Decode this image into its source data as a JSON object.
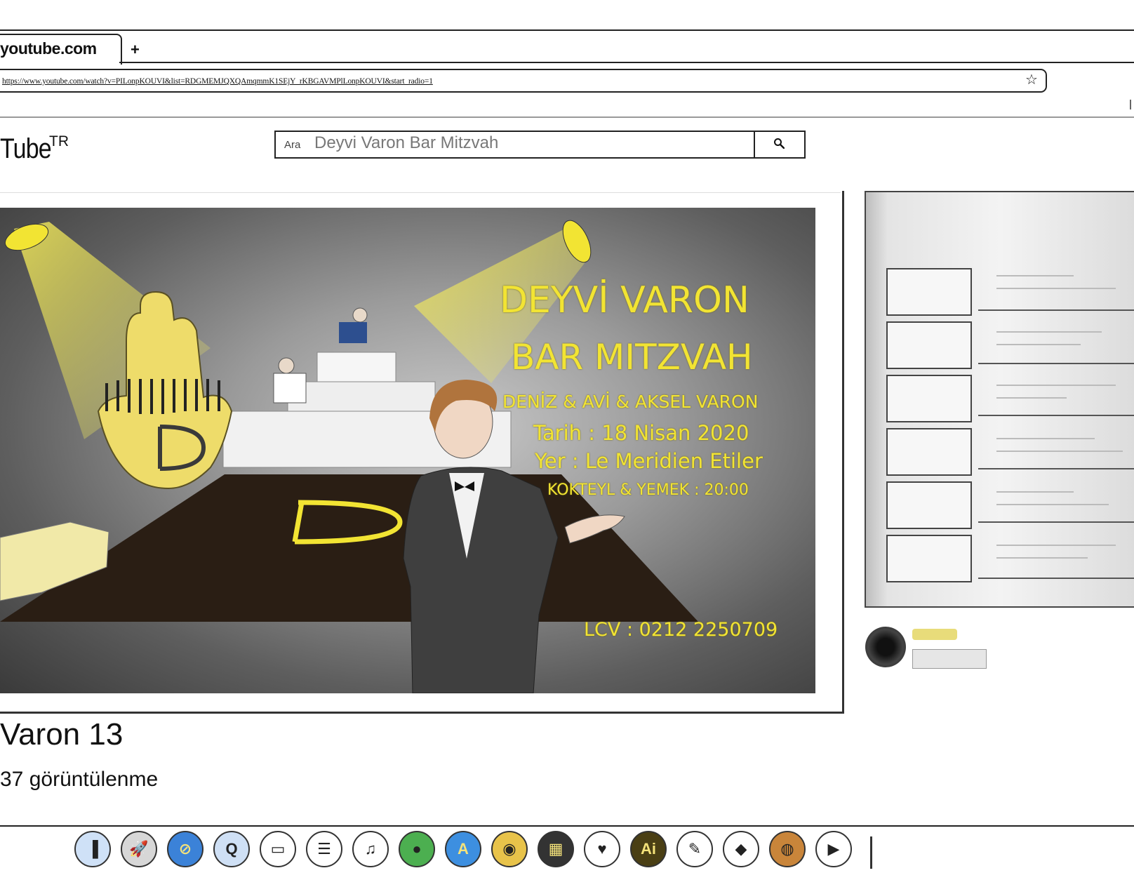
{
  "browser": {
    "tab_title": "youtube.com",
    "new_tab": "+",
    "url": "https://www.youtube.com/watch?v=PILonpKOUVI&list=RDGMEMJQXQAmqmmK1SEjY_rKBGAVMPlLonpKOUVI&start_radio=1",
    "bookmark_star": "☆"
  },
  "youtube": {
    "logo_text": "Tube",
    "region": "TR",
    "search_prefix": "Ara",
    "search_value": "Deyvi Varon Bar Mitzvah"
  },
  "video": {
    "name": "DEYVİ VARON",
    "event": "BAR MITZVAH",
    "hosts": "DENİZ & AVİ & AKSEL VARON",
    "date": "Tarih : 18 Nisan 2020",
    "place": "Yer : Le Meridien Etiler",
    "time": "KOKTEYL & YEMEK : 20:00",
    "rsvp": "LCV : 0212 2250709",
    "logo_letter": "D",
    "accent_color": "#f2e433"
  },
  "caption": {
    "title": "Varon 13",
    "views": "37 görüntülenme"
  },
  "dock": {
    "items": [
      {
        "name": "finder-icon",
        "glyph": "▐",
        "bg": "#cfe1f7"
      },
      {
        "name": "launchpad-icon",
        "glyph": "🚀",
        "bg": "#d7d7d7"
      },
      {
        "name": "safari-icon",
        "glyph": "⊘",
        "bg": "#3b82d8"
      },
      {
        "name": "quicktime-icon",
        "glyph": "Q",
        "bg": "#cfe0f5"
      },
      {
        "name": "calendar-icon",
        "glyph": "▭",
        "bg": "#ffffff"
      },
      {
        "name": "notes-icon",
        "glyph": "☰",
        "bg": "#ffffff"
      },
      {
        "name": "itunes-icon",
        "glyph": "♫",
        "bg": "#ffffff"
      },
      {
        "name": "facetime-icon",
        "glyph": "●",
        "bg": "#4caf50"
      },
      {
        "name": "app-store-icon",
        "glyph": "A",
        "bg": "#3d8fe0"
      },
      {
        "name": "chrome-icon",
        "glyph": "◉",
        "bg": "#e8c34a"
      },
      {
        "name": "photo-booth-icon",
        "glyph": "▦",
        "bg": "#333333"
      },
      {
        "name": "pocket-icon",
        "glyph": "♥",
        "bg": "#ffffff"
      },
      {
        "name": "illustrator-icon",
        "glyph": "Ai",
        "bg": "#4a3f14"
      },
      {
        "name": "pencil-app-icon",
        "glyph": "✎",
        "bg": "#ffffff"
      },
      {
        "name": "inkscape-icon",
        "glyph": "◆",
        "bg": "#ffffff"
      },
      {
        "name": "world-app-icon",
        "glyph": "◍",
        "bg": "#c9853a"
      },
      {
        "name": "media-player-icon",
        "glyph": "▶",
        "bg": "#ffffff"
      }
    ]
  }
}
